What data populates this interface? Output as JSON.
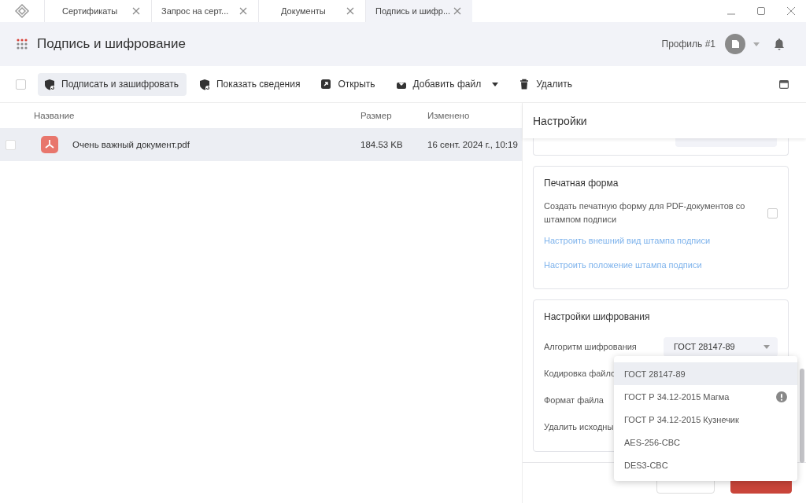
{
  "tabs": [
    {
      "label": "Сертификаты",
      "selected": false
    },
    {
      "label": "Запрос на серт...",
      "selected": false
    },
    {
      "label": "Документы",
      "selected": false
    },
    {
      "label": "Подпись и шифр...",
      "selected": true
    }
  ],
  "header": {
    "title": "Подпись и шифрование",
    "profile": "Профиль #1"
  },
  "select_all": {
    "checked": false
  },
  "toolbar": [
    {
      "label": "Подписать и зашифровать",
      "kind": "shield",
      "selected": true,
      "caret": false
    },
    {
      "label": "Показать сведения",
      "kind": "shield",
      "selected": false,
      "caret": false
    },
    {
      "label": "Открыть",
      "kind": "open",
      "selected": false,
      "caret": false
    },
    {
      "label": "Добавить файл",
      "kind": "add",
      "selected": false,
      "caret": true
    },
    {
      "label": "Удалить",
      "kind": "trash",
      "selected": false,
      "caret": false
    }
  ],
  "table": {
    "columns": [
      "Название",
      "Размер",
      "Изменено"
    ],
    "rows": [
      {
        "name": "Очень важный документ.pdf",
        "size": "184.53 KB",
        "modified": "16 сент. 2024 г., 10:19",
        "selected": true,
        "checked": false
      }
    ]
  },
  "settings": {
    "title": "Настройки",
    "print_form": {
      "title": "Печатная форма",
      "option": {
        "label": "Создать печатную форму для PDF-документов со штампом подписи",
        "checked": false
      },
      "links": [
        "Настроить внешний вид штампа подписи",
        "Настроить положение штампа подписи"
      ]
    },
    "encryption": {
      "title": "Настройки шифрования",
      "fields": [
        {
          "label": "Алгоритм шифрования",
          "value": "ГОСТ 28147-89"
        },
        {
          "label": "Кодировка файло"
        },
        {
          "label": "Формат файла"
        },
        {
          "label": "Удалить исходны"
        }
      ]
    },
    "dropdown": [
      {
        "label": "ГОСТ 28147-89",
        "selected": true,
        "warning": false
      },
      {
        "label": "ГОСТ Р 34.12-2015 Магма",
        "selected": false,
        "warning": true
      },
      {
        "label": "ГОСТ Р 34.12-2015 Кузнечик",
        "selected": false,
        "warning": false
      },
      {
        "label": "AES-256-CBC",
        "selected": false,
        "warning": false
      },
      {
        "label": "DES3-CBC",
        "selected": false,
        "warning": false
      }
    ]
  }
}
